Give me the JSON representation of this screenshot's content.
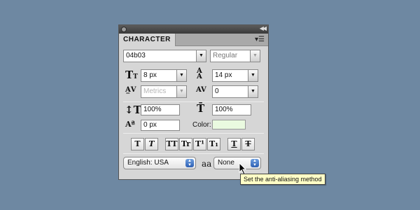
{
  "panel": {
    "tab_title": "CHARACTER",
    "menu_icon": "panel-menu-icon",
    "collapse_icon": "collapse-icon"
  },
  "font": {
    "family": "04b03",
    "style": "Regular"
  },
  "size": {
    "font_size": "8 px",
    "leading": "14 px"
  },
  "kerning": {
    "value": "Metrics",
    "tracking": "0"
  },
  "scale": {
    "vertical": "100%",
    "horizontal": "100%"
  },
  "baseline": {
    "shift": "0 px"
  },
  "color": {
    "label": "Color:",
    "value": "#eafae0"
  },
  "style_buttons": [
    "T",
    "T",
    "TT",
    "Tr",
    "T¹",
    "T₁",
    "T",
    "T"
  ],
  "language": "English: USA",
  "antialias": {
    "icon": "aa",
    "value": "None",
    "tooltip": "Set the anti-aliasing method"
  }
}
